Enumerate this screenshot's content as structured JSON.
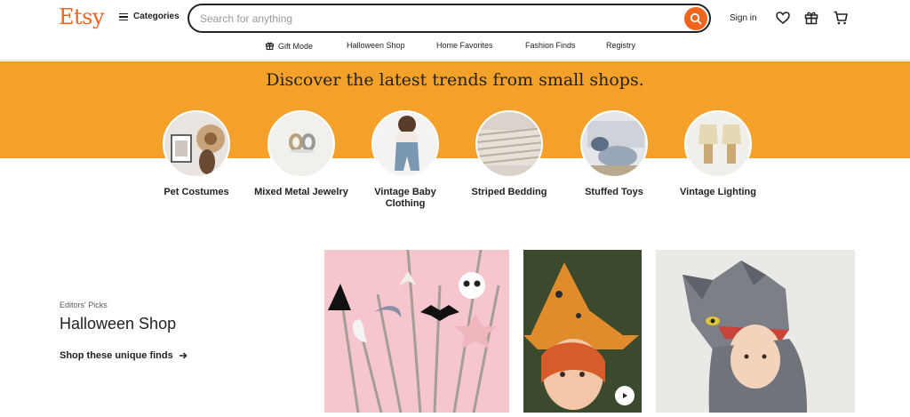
{
  "header": {
    "logo": "Etsy",
    "categories_label": "Categories",
    "search_placeholder": "Search for anything",
    "search_value": "",
    "sign_in": "Sign in"
  },
  "subnav": [
    {
      "label": "Gift Mode",
      "icon": "gift-icon"
    },
    {
      "label": "Halloween Shop"
    },
    {
      "label": "Home Favorites"
    },
    {
      "label": "Fashion Finds"
    },
    {
      "label": "Registry"
    }
  ],
  "banner": {
    "title": "Discover the latest trends from small shops."
  },
  "categories": [
    {
      "label": "Pet Costumes"
    },
    {
      "label": "Mixed Metal Jewelry"
    },
    {
      "label": "Vintage Baby Clothing"
    },
    {
      "label": "Striped Bedding"
    },
    {
      "label": "Stuffed Toys"
    },
    {
      "label": "Vintage Lighting"
    }
  ],
  "editors_picks": {
    "kicker": "Editors' Picks",
    "title": "Halloween Shop",
    "link": "Shop these unique finds"
  },
  "colors": {
    "brand": "#f1641e",
    "banner": "#f4a12c"
  }
}
